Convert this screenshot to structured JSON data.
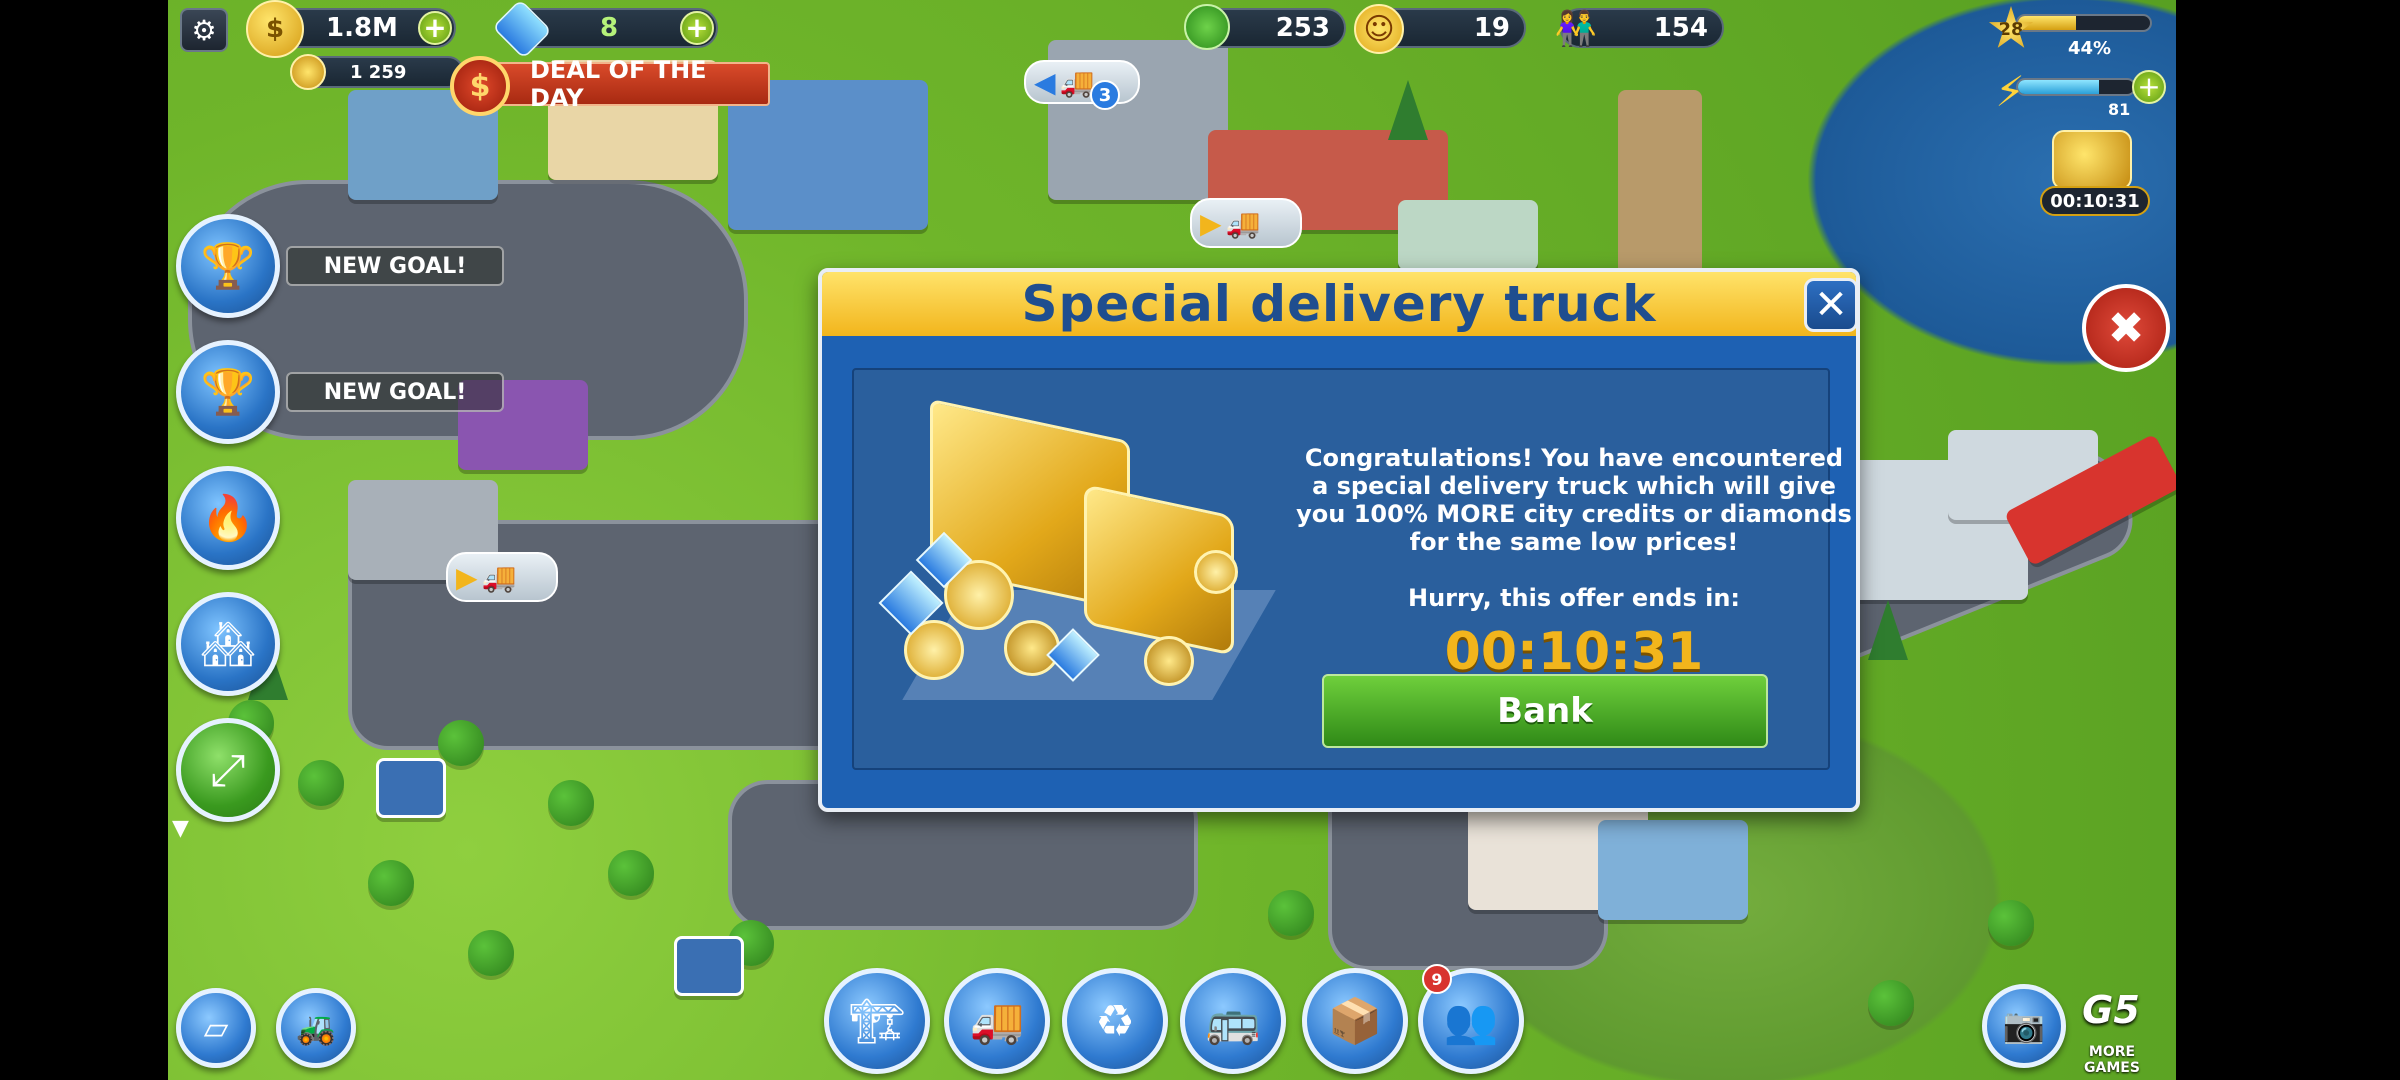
{
  "hud": {
    "credits": "1.8M",
    "diamonds": "8",
    "sub_credits": "1 259",
    "deal_label": "DEAL OF THE DAY",
    "trees": "253",
    "happiness": "19",
    "population": "154",
    "level": "28",
    "xp_percent": "44%",
    "energy": "81",
    "bonus_timer": "00:10:31",
    "truck_queue": "3"
  },
  "goals": [
    {
      "label": "NEW GOAL!"
    },
    {
      "label": "NEW GOAL!"
    }
  ],
  "dialog": {
    "title": "Special delivery truck",
    "body": "Congratulations! You have encountered a special delivery truck which will give you 100% MORE city credits or diamonds for the same low prices!",
    "hurry": "Hurry, this offer ends in:",
    "timer": "00:10:31",
    "button": "Bank"
  },
  "bottom": {
    "friends_badge": "9",
    "more_games": "MORE GAMES"
  },
  "colors": {
    "dialog_bg": "#1e61b3",
    "header": "#f2b51c",
    "timer": "#f2b51c",
    "bank_button": "#3a9a1f"
  }
}
